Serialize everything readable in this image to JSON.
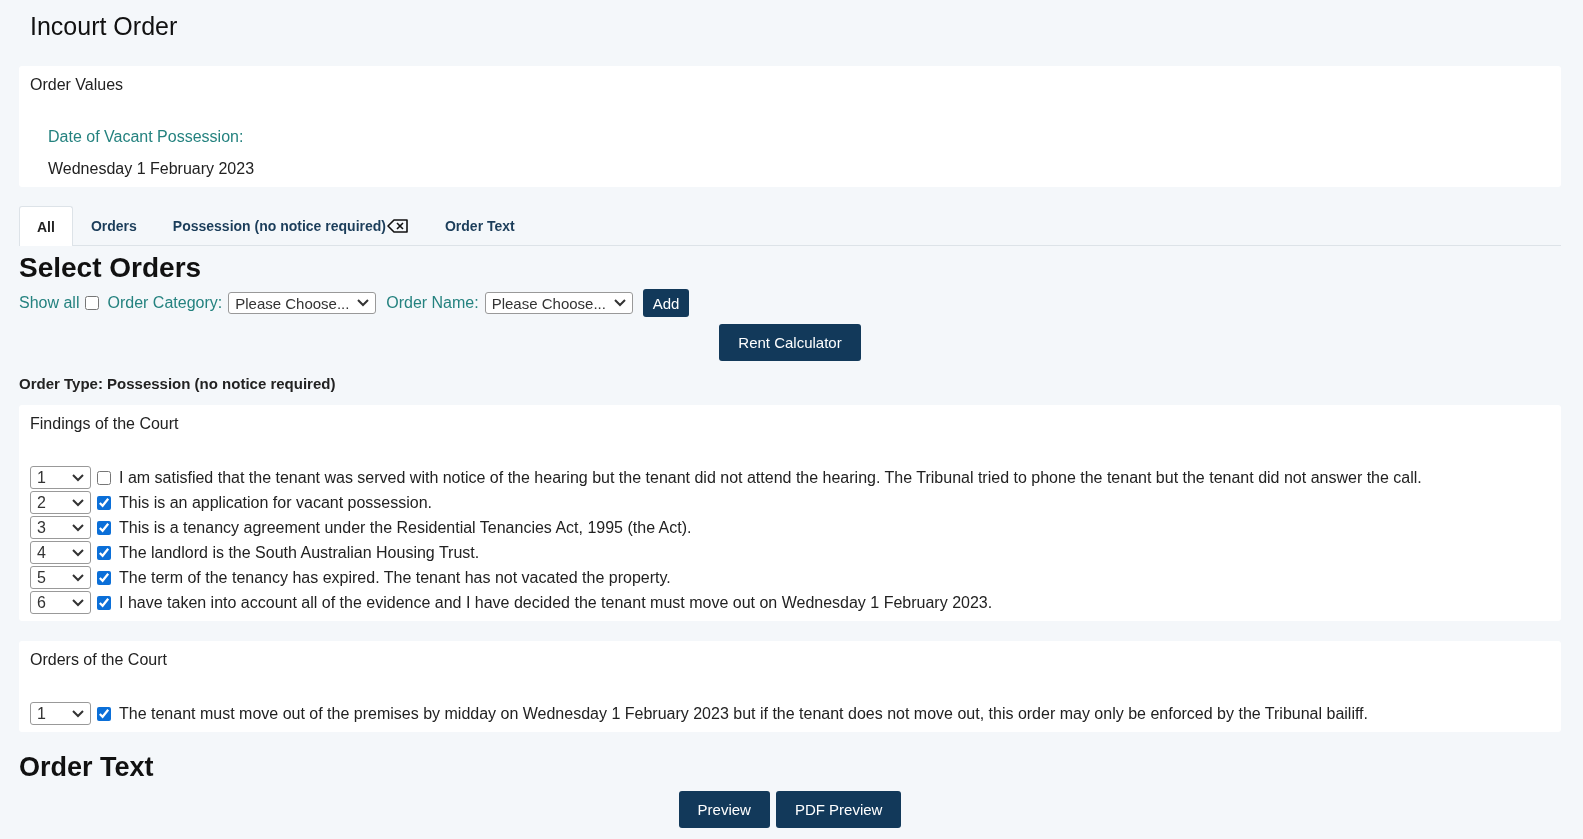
{
  "page": {
    "title": "Incourt Order"
  },
  "order_values": {
    "heading": "Order Values",
    "field_label": "Date of Vacant Possession:",
    "field_value": "Wednesday 1 February 2023"
  },
  "tabs": [
    {
      "label": "All",
      "selected": true,
      "closable": false
    },
    {
      "label": "Orders",
      "selected": false,
      "closable": false
    },
    {
      "label": "Possession (no notice required)",
      "selected": false,
      "closable": true
    },
    {
      "label": "Order Text",
      "selected": false,
      "closable": false
    }
  ],
  "select_orders": {
    "heading": "Select Orders",
    "show_all_label": "Show all",
    "show_all_checked": false,
    "category_label": "Order Category:",
    "category_value": "Please Choose...",
    "name_label": "Order Name:",
    "name_value": "Please Choose...",
    "add_button": "Add",
    "rent_button": "Rent Calculator"
  },
  "order_type": "Order Type: Possession (no notice required)",
  "sections": [
    {
      "heading": "Findings of the Court",
      "items": [
        {
          "number": "1",
          "checked": false,
          "text": "I am satisfied that the tenant was served with notice of the hearing but the tenant did not attend the hearing. The Tribunal tried to phone the tenant but the tenant did not answer the call."
        },
        {
          "number": "2",
          "checked": true,
          "text": "This is an application for vacant possession."
        },
        {
          "number": "3",
          "checked": true,
          "text": "This is a tenancy agreement under the Residential Tenancies Act, 1995 (the Act)."
        },
        {
          "number": "4",
          "checked": true,
          "text": "The landlord is the South Australian Housing Trust."
        },
        {
          "number": "5",
          "checked": true,
          "text": "The term of the tenancy has expired. The tenant has not vacated the property."
        },
        {
          "number": "6",
          "checked": true,
          "text": "I have taken into account all of the evidence and I have decided the tenant must move out on Wednesday 1 February 2023."
        }
      ]
    },
    {
      "heading": "Orders of the Court",
      "items": [
        {
          "number": "1",
          "checked": true,
          "text": "The tenant must move out of the premises by midday on Wednesday 1 February 2023 but if the tenant does not move out, this order may only be enforced by the Tribunal bailiff."
        }
      ]
    }
  ],
  "order_text": {
    "heading": "Order Text",
    "buttons": [
      "Preview",
      "PDF Preview"
    ]
  }
}
